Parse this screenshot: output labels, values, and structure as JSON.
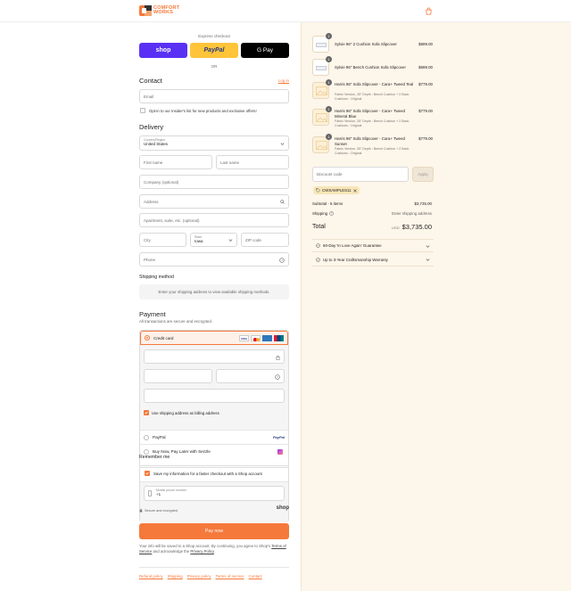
{
  "brand": {
    "line1": "COMFORT",
    "line2": "WORKS"
  },
  "express": {
    "title": "Express checkout",
    "shop": "shop",
    "paypal": "PayPal",
    "gpay": "G Pay",
    "or": "OR"
  },
  "contact": {
    "title": "Contact",
    "login": "Log in",
    "email_placeholder": "Email",
    "optin": "Opt-in to our Insider's list for new products and exclusive offers!"
  },
  "delivery": {
    "title": "Delivery",
    "country_label": "Country/Region",
    "country_value": "United States",
    "first_name": "First name",
    "last_name": "Last name",
    "company": "Company (optional)",
    "address": "Address",
    "apartment": "Apartment, suite, etc. (optional)",
    "city": "City",
    "state_label": "State",
    "state_value": "Iowa",
    "zip": "ZIP code",
    "phone": "Phone"
  },
  "shipping_method": {
    "title": "Shipping method",
    "message": "Enter your shipping address to view available shipping methods."
  },
  "payment": {
    "title": "Payment",
    "subtitle": "All transactions are secure and encrypted.",
    "credit_card": "Credit card",
    "card_brands": [
      "VISA",
      "MC",
      "AMEX",
      "UP"
    ],
    "billing_same": "Use shipping address as billing address",
    "paypal": "PayPal",
    "paypal_logo": "PayPal",
    "sezzle": "Buy Now, Pay Later with Sezzle"
  },
  "remember": {
    "title": "Remember me",
    "save_info": "Save my information for a faster checkout with a Shop account",
    "mobile_label": "Mobile phone number",
    "mobile_value": "+1",
    "secure": "Secure and encrypted",
    "shop": "shop"
  },
  "pay_now": "Pay now",
  "disclaimer": {
    "text1": "Your info will be saved to a Shop account. By continuing, you agree to Shop's",
    "terms": "Terms of Service",
    "text2": "and acknowledge the",
    "privacy": "Privacy Policy",
    "end": "."
  },
  "footer": [
    "Refund policy",
    "Shipping",
    "Privacy policy",
    "Terms of service",
    "Contact"
  ],
  "cart": {
    "items": [
      {
        "qty": "1",
        "name": "Sylvie 96\" 2 Cushion Sofa Slipcover",
        "meta": "",
        "price": "$699.00"
      },
      {
        "qty": "1",
        "name": "Sylvie 96\" Bench Cushion Sofa Slipcover",
        "meta": "",
        "price": "$699.00"
      },
      {
        "qty": "1",
        "name": "Harris 96\" Sofa Slipcover - Cara+ Tweed Teal",
        "meta": "Fabric Version, 35\" Depth : Bench Cushion + 2 Back Cushions : Original",
        "price": "$779.00"
      },
      {
        "qty": "1",
        "name": "Harris 96\" Sofa Slipcover - Cara+ Tweed Mineral Blue",
        "meta": "Fabric Version, 35\" Depth : Bench Cushion + 2 Back Cushions : Original",
        "price": "$779.00"
      },
      {
        "qty": "1",
        "name": "Harris 96\" Sofa Slipcover - Cara+ Tweed Sunset",
        "meta": "Fabric Version, 35\" Depth : Bench Cushion + 2 Back Cushions : Original",
        "price": "$779.00"
      }
    ],
    "discount_placeholder": "Discount code",
    "apply": "Apply",
    "discount_tag": "CWSAMPLES11",
    "subtotal_label": "Subtotal · 5 items",
    "subtotal_value": "$3,735.00",
    "shipping_label": "Shipping",
    "shipping_value": "Enter shipping address",
    "total_label": "Total",
    "currency": "USD",
    "total_value": "$3,735.00",
    "guarantee": "60-Day 'In Love Again' Guarantee",
    "warranty": "Up to 3-Year Craftsmanship Warranty"
  },
  "colors": {
    "accent": "#f5793b",
    "shop": "#5a31f4",
    "paypal": "#ffc439",
    "sidebar": "#fdf6ea"
  }
}
